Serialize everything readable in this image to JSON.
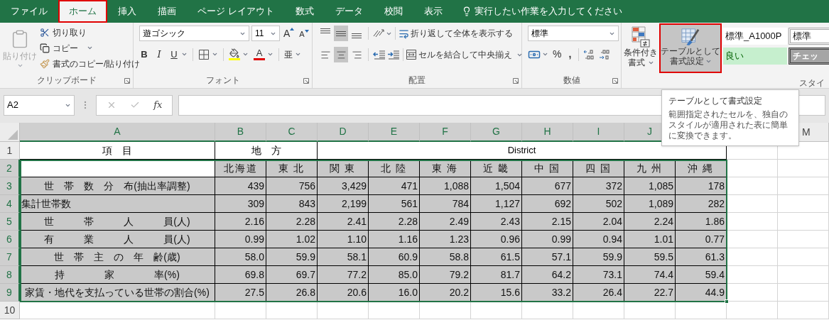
{
  "tabs": [
    {
      "label": "ファイル",
      "selected": false,
      "highlighted": false
    },
    {
      "label": "ホーム",
      "selected": true,
      "highlighted": true
    },
    {
      "label": "挿入",
      "selected": false,
      "highlighted": false
    },
    {
      "label": "描画",
      "selected": false,
      "highlighted": false
    },
    {
      "label": "ページ レイアウト",
      "selected": false,
      "highlighted": false
    },
    {
      "label": "数式",
      "selected": false,
      "highlighted": false
    },
    {
      "label": "データ",
      "selected": false,
      "highlighted": false
    },
    {
      "label": "校閲",
      "selected": false,
      "highlighted": false
    },
    {
      "label": "表示",
      "selected": false,
      "highlighted": false
    }
  ],
  "tell_me": "実行したい作業を入力してください",
  "ribbon": {
    "clipboard": {
      "label": "クリップボード",
      "paste": {
        "label": "貼り付け",
        "disabled": true
      },
      "cut": "切り取り",
      "copy": "コピー",
      "format_painter": "書式のコピー/貼り付け"
    },
    "font": {
      "label": "フォント",
      "font_name": "遊ゴシック",
      "font_size": "11",
      "grow": "A",
      "shrink": "A",
      "bold": "B",
      "italic": "I",
      "underline": "U",
      "font_color": "A",
      "phonetic": "亜"
    },
    "alignment": {
      "label": "配置",
      "vertical_buttons": [
        {
          "selected": false
        },
        {
          "selected": true
        },
        {
          "selected": false
        }
      ],
      "horizontal_buttons": [
        {
          "selected": false
        },
        {
          "selected": true
        },
        {
          "selected": false
        }
      ],
      "wrap_text": "折り返して全体を表示する",
      "merge_center": "セルを結合して中央揃え"
    },
    "number": {
      "label": "数値",
      "format": "標準",
      "percent": "%",
      "comma": ","
    },
    "styles": {
      "label": "スタイ",
      "conditional": [
        "条件付き",
        "書式"
      ],
      "table_format": {
        "lines": [
          "テーブルとして",
          "書式設定"
        ],
        "highlighted": true
      },
      "gallery": [
        {
          "label": "標準_A1000P",
          "kind": "plain"
        },
        {
          "label": "標準",
          "kind": "boxed"
        },
        {
          "label": "良い",
          "kind": "good"
        },
        {
          "label": "チェッ",
          "kind": "check"
        }
      ]
    }
  },
  "formula_bar": {
    "name_box": "A2",
    "function_label": "fx"
  },
  "tooltip": {
    "title": "テーブルとして書式設定",
    "body": "範囲指定されたセルを、独自のスタイルが適用された表に簡単に変換できます。"
  },
  "sheet": {
    "columns": [
      {
        "label": "A",
        "selected": true
      },
      {
        "label": "B",
        "selected": true
      },
      {
        "label": "C",
        "selected": true
      },
      {
        "label": "D",
        "selected": true
      },
      {
        "label": "E",
        "selected": true
      },
      {
        "label": "F",
        "selected": true
      },
      {
        "label": "G",
        "selected": true
      },
      {
        "label": "H",
        "selected": true
      },
      {
        "label": "I",
        "selected": true
      },
      {
        "label": "J",
        "selected": true
      }
    ],
    "trailing_columns": [
      {
        "label": "M",
        "selected": false
      }
    ],
    "title_row": {
      "number": "1",
      "selected": false,
      "item": "項　目",
      "region": "地　方",
      "district": "District"
    },
    "header_row": {
      "number": "2",
      "selected": true,
      "regions": [
        "北海道",
        "東 北",
        "関 東",
        "北 陸",
        "東 海",
        "近 畿",
        "中 国",
        "四 国",
        "九 州",
        "沖 縄"
      ]
    },
    "data_rows": [
      {
        "number": "3",
        "selected": true,
        "label": "世　帯　数　分　布(抽出率調整)",
        "kind": "centered",
        "values": [
          "439",
          "756",
          "3,429",
          "471",
          "1,088",
          "1,504",
          "677",
          "372",
          "1,085",
          "178"
        ]
      },
      {
        "number": "4",
        "selected": true,
        "label": "集計世帯数",
        "kind": "distributed",
        "values": [
          "309",
          "843",
          "2,199",
          "561",
          "784",
          "1,127",
          "692",
          "502",
          "1,089",
          "282"
        ]
      },
      {
        "number": "5",
        "selected": true,
        "label": "世　　　帯　　　人　　　員(人)",
        "kind": "centered",
        "values": [
          "2.16",
          "2.28",
          "2.41",
          "2.28",
          "2.49",
          "2.43",
          "2.15",
          "2.04",
          "2.24",
          "1.86"
        ]
      },
      {
        "number": "6",
        "selected": true,
        "label": "有　　　業　　　人　　　員(人)",
        "kind": "centered",
        "values": [
          "0.99",
          "1.02",
          "1.10",
          "1.16",
          "1.23",
          "0.96",
          "0.99",
          "0.94",
          "1.01",
          "0.77"
        ]
      },
      {
        "number": "7",
        "selected": true,
        "label": "世　帯　主　の　年　齢(歳)",
        "kind": "centered",
        "values": [
          "58.0",
          "59.9",
          "58.1",
          "60.9",
          "58.8",
          "61.5",
          "57.1",
          "59.9",
          "59.5",
          "61.3"
        ]
      },
      {
        "number": "8",
        "selected": true,
        "label": "持　　　　家　　　　率(%)",
        "kind": "centered",
        "values": [
          "69.8",
          "69.7",
          "77.2",
          "85.0",
          "79.2",
          "81.7",
          "64.2",
          "73.1",
          "74.4",
          "59.4"
        ]
      },
      {
        "number": "9",
        "selected": true,
        "label": "家賃・地代を支払っている世帯の割合(%)",
        "kind": "small",
        "values": [
          "27.5",
          "26.8",
          "20.6",
          "16.0",
          "20.2",
          "15.6",
          "33.2",
          "26.4",
          "22.7",
          "44.9"
        ]
      }
    ],
    "empty_row": {
      "number": "10",
      "selected": false
    }
  }
}
